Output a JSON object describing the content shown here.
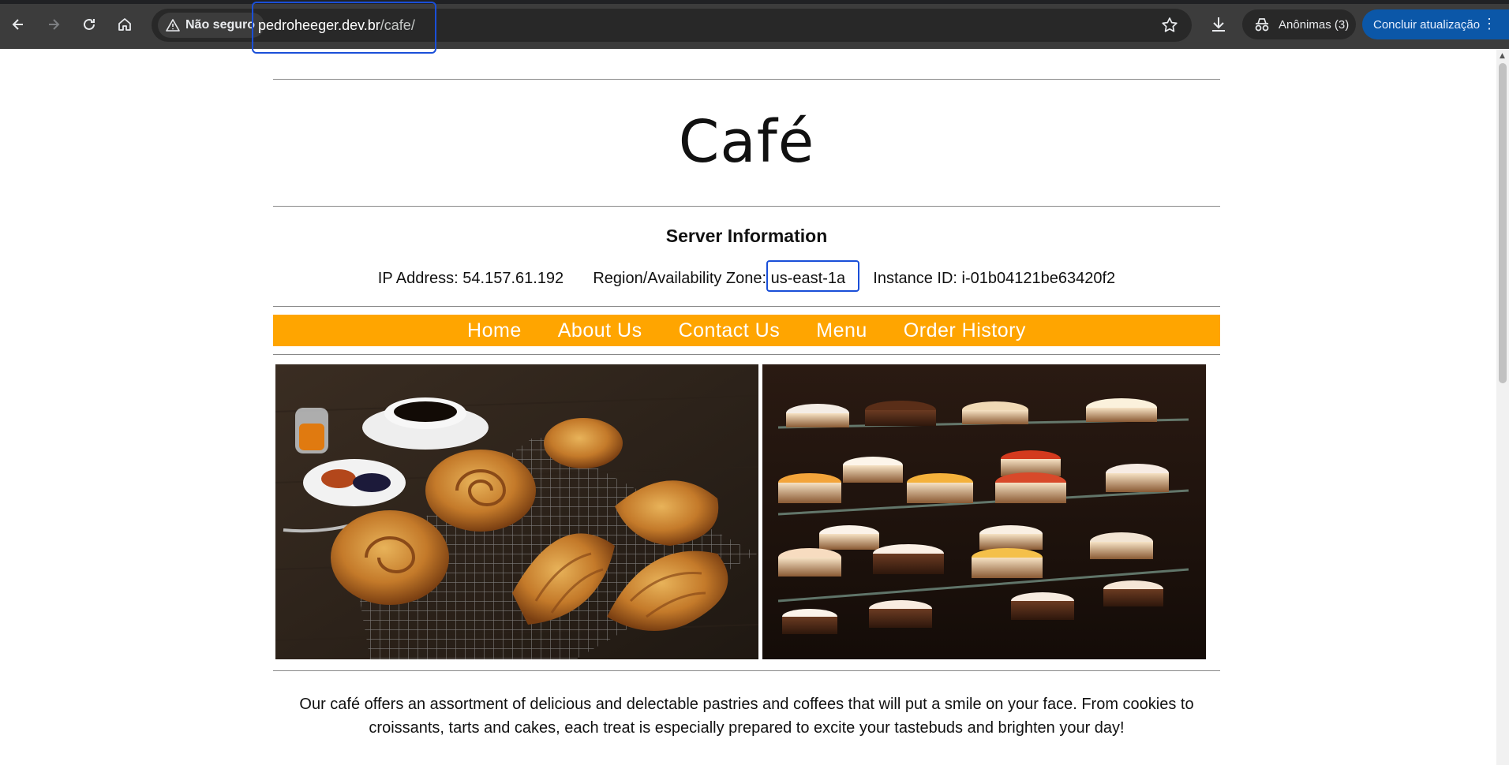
{
  "browser": {
    "security_label": "Não seguro",
    "url_host": "pedroheeger.dev.br",
    "url_path": "/cafe/",
    "incognito_label": "Anônimas (3)",
    "update_label": "Concluir atualização",
    "icons": [
      "back-arrow-icon",
      "forward-arrow-icon",
      "reload-icon",
      "home-icon",
      "warning-icon",
      "star-icon",
      "download-icon",
      "incognito-icon",
      "more-vert-icon"
    ]
  },
  "site": {
    "title": "Café",
    "server_heading": "Server Information",
    "ip_label": "IP Address:",
    "ip_value": "54.157.61.192",
    "region_label": "Region/Availability Zone:",
    "region_value": "us-east-1a",
    "instance_label": "Instance ID:",
    "instance_value": "i-01b04121be63420f2"
  },
  "nav": {
    "items": [
      "Home",
      "About Us",
      "Contact Us",
      "Menu",
      "Order History"
    ]
  },
  "description": "Our café offers an assortment of delicious and delectable pastries and coffees that will put a smile on your face. From cookies to croissants, tarts and cakes, each treat is especially prepared to excite your tastebuds and brighten your day!",
  "colors": {
    "nav_bar": "#ffa500",
    "annotation": "#1a4fd8",
    "chrome_bg": "#3c3c3c",
    "update_button": "#0b57a8"
  }
}
